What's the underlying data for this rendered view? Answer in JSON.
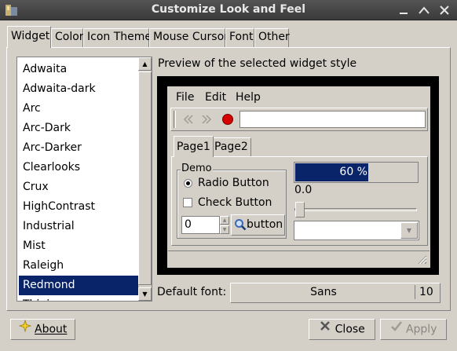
{
  "window": {
    "title": "Customize Look and Feel"
  },
  "titlebar_buttons": [
    "minimize",
    "maximize",
    "close"
  ],
  "tabs": [
    {
      "label": "Widget",
      "active": true
    },
    {
      "label": "Color"
    },
    {
      "label": "Icon Theme"
    },
    {
      "label": "Mouse Cursor"
    },
    {
      "label": "Font"
    },
    {
      "label": "Other"
    }
  ],
  "theme_list": {
    "items": [
      "Adwaita",
      "Adwaita-dark",
      "Arc",
      "Arc-Dark",
      "Arc-Darker",
      "Clearlooks",
      "Crux",
      "HighContrast",
      "Industrial",
      "Mist",
      "Raleigh",
      "Redmond",
      "Thinice"
    ],
    "selected": "Redmond"
  },
  "preview": {
    "label": "Preview of the selected widget style",
    "menu": [
      "File",
      "Edit",
      "Help"
    ],
    "toolbar": {
      "icons": [
        "back-arrow-icon",
        "forward-arrow-icon",
        "stop-icon"
      ],
      "entry_value": ""
    },
    "tabs": [
      {
        "label": "Page1",
        "active": true
      },
      {
        "label": "Page2"
      }
    ],
    "demo": {
      "legend": "Demo",
      "radio_label": "Radio Button",
      "radio_checked": true,
      "check_label": "Check Button",
      "check_checked": false,
      "spin_value": "0",
      "button_label": "button"
    },
    "progress": {
      "fraction": 0.6,
      "label": "60 %"
    },
    "scale": {
      "value": "0.0",
      "fraction": 0.0
    },
    "combo_value": ""
  },
  "default_font": {
    "label": "Default font:",
    "name": "Sans",
    "size": "10"
  },
  "buttons": {
    "about": "About",
    "close": "Close",
    "apply": "Apply"
  },
  "colors": {
    "selection": "#0a246a",
    "window_bg": "#d4d0c8",
    "titlebar": "#4a4a4a",
    "stop_red": "#d40000"
  }
}
